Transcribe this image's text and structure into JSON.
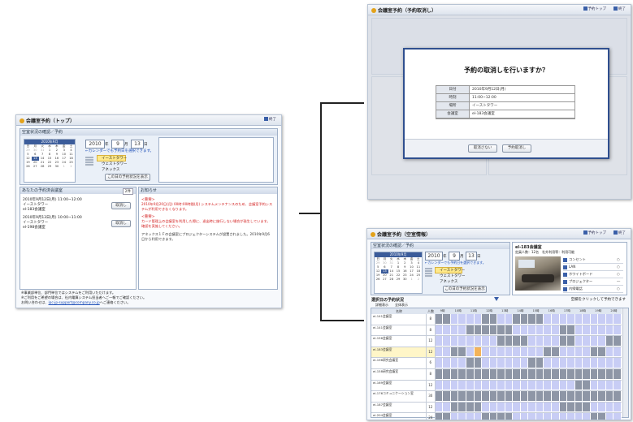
{
  "top": {
    "title": "会議室予約（トップ）",
    "end": "終了",
    "status_header": "空室状況の確認／予約",
    "calendar_title": "2010年9月",
    "year": "2010",
    "month": "9",
    "day": "13",
    "year_unit": "年",
    "month_unit": "月",
    "day_unit": "日",
    "calendar_hint": "←カレンダーでも予約日を選択できます。",
    "towers": [
      "イーストタワー",
      "ウェストタワー",
      "アネックス"
    ],
    "show_button": "この日の予約状況を表示",
    "my_header": "あなたの予約済会議室",
    "my_count": "2件",
    "reservations": [
      {
        "line1": "2010年9月12日(月) 11:00~12:00",
        "line2": "イーストタワー",
        "line3": "el-183会議室",
        "btn": "取消し"
      },
      {
        "line1": "2010年9月13日(月) 10:00~11:00",
        "line2": "イーストタワー",
        "line3": "el-198会議室",
        "btn": "取消し"
      }
    ],
    "news_header": "お知らせ",
    "news": [
      "<重要>",
      "2010年9月20日(月) 00時:00時間(月) システムメンテナンスのため、会議室予約システムが利用できなくなります。",
      "<重要>",
      "カード管理上の会議室を利用した際に、退出時に施行しない場合が発生しています。確認を実施してください。",
      "アネックス１Ｆの会議室にプロジェクターシステムが設置されました。2010年9月6日から利用できます。"
    ],
    "footer": [
      "※事業部単位、部門単位ではシステムをご利用いただけます。",
      "※ご利用をご希望の場合は、社内電算システム担当者へご一報でご確認ください。",
      "お問い合わせは、"
    ],
    "footer_link": "ipc-jp-support@company.co.jp",
    "footer_tail": "へご連絡ください。"
  },
  "cancel": {
    "title": "会議室予約（予約取消し）",
    "header_btn1": "予約トップ",
    "header_btn2": "終了",
    "dialog_title": "予約の取消しを行いますか？",
    "rows": [
      {
        "label": "日付",
        "value": "2010年9月12日(月)"
      },
      {
        "label": "時刻",
        "value": "11:00~12:00"
      },
      {
        "label": "場所",
        "value": "イーストタワー"
      },
      {
        "label": "会議室",
        "value": "el-183会議室"
      }
    ],
    "no_button": "取消さない",
    "yes_button": "予約取消し"
  },
  "room": {
    "title": "会議室予約（空室情報）",
    "header_btn1": "予約トップ",
    "header_btn2": "終了",
    "room_name": "el-183会議室",
    "room_info": "定員人数：12名　社外利用等：利用可能",
    "equipment": [
      {
        "name": "コンセント",
        "mark": "○"
      },
      {
        "name": "LAN",
        "mark": "○"
      },
      {
        "name": "ホワイトボード",
        "mark": "○"
      },
      {
        "name": "プロジェクター",
        "mark": "―"
      },
      {
        "name": "内線電話",
        "mark": "○"
      }
    ],
    "select_status": "選択日の予約状況",
    "click_hint": "空欄をクリックして予約できます",
    "filter1": "詳細表示",
    "filter2": "全体表示",
    "col_name": "名称",
    "col_people": "人数",
    "hours": [
      "9時",
      "10時",
      "11時",
      "12時",
      "13時",
      "14時",
      "15時",
      "16時",
      "17時",
      "18時",
      "19時",
      "20時"
    ],
    "rooms": [
      {
        "name": "el-141会議室",
        "people": "8"
      },
      {
        "name": "el-141会議室",
        "people": "8"
      },
      {
        "name": "el-156会議室",
        "people": "12"
      },
      {
        "name": "el-183会議室",
        "people": "12"
      },
      {
        "name": "el-196研究会議室",
        "people": "6"
      },
      {
        "name": "el-158研究会議室",
        "people": "8"
      },
      {
        "name": "el-169会議室",
        "people": "12"
      },
      {
        "name": "el-176コミュニケーション室",
        "people": "30"
      },
      {
        "name": "el-187会議室",
        "people": "12"
      },
      {
        "name": "el-204会議室",
        "people": "24"
      }
    ]
  }
}
